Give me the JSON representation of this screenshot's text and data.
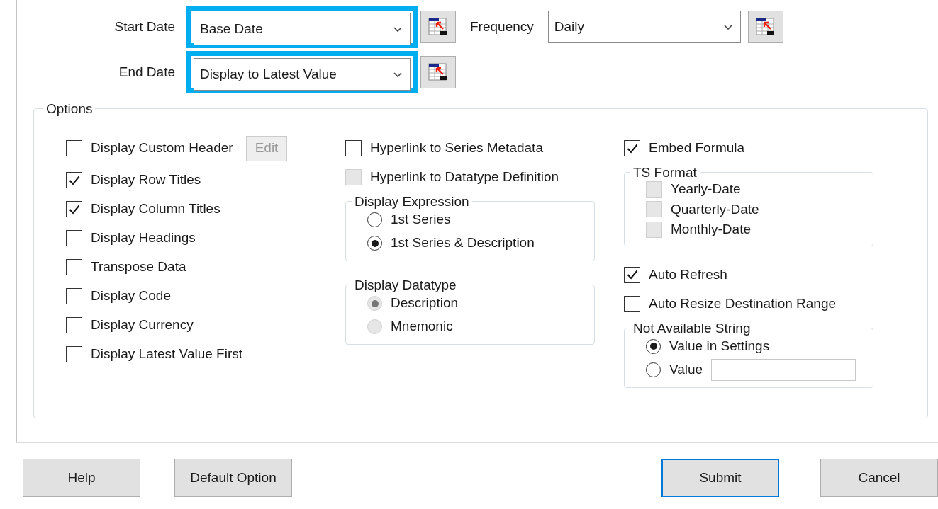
{
  "date_fields": [
    {
      "label": "Start Date",
      "value": "Base Date",
      "highlighted": true
    },
    {
      "label": "End Date",
      "value": "Display to Latest Value",
      "highlighted": true
    }
  ],
  "frequency": {
    "label": "Frequency",
    "value": "Daily"
  },
  "options": {
    "title": "Options",
    "columns": [
      [
        {
          "kind": "checkbox",
          "label": "Display Custom Header",
          "checked": false,
          "disabled": false,
          "button": {
            "label": "Edit",
            "disabled": true
          }
        },
        {
          "kind": "checkbox",
          "label": "Display Row Titles",
          "checked": true,
          "disabled": false
        },
        {
          "kind": "checkbox",
          "label": "Display Column Titles",
          "checked": true,
          "disabled": false
        },
        {
          "kind": "checkbox",
          "label": "Display Headings",
          "checked": false,
          "disabled": false
        },
        {
          "kind": "checkbox",
          "label": "Transpose Data",
          "checked": false,
          "disabled": false
        },
        {
          "kind": "checkbox",
          "label": "Display Code",
          "checked": false,
          "disabled": false
        },
        {
          "kind": "checkbox",
          "label": "Display Currency",
          "checked": false,
          "disabled": false
        },
        {
          "kind": "checkbox",
          "label": "Display Latest Value First",
          "checked": false,
          "disabled": false
        }
      ],
      [
        {
          "kind": "checkbox",
          "label": "Hyperlink to Series Metadata",
          "checked": false,
          "disabled": false
        },
        {
          "kind": "checkbox",
          "label": "Hyperlink to Datatype Definition",
          "checked": false,
          "disabled": true
        },
        {
          "kind": "radio_group",
          "title": "Display Expression",
          "options": [
            {
              "kind": "radio",
              "label": "1st Series",
              "selected": false,
              "disabled": false
            },
            {
              "kind": "radio",
              "label": "1st Series & Description",
              "selected": true,
              "disabled": false
            }
          ]
        },
        {
          "kind": "radio_group",
          "title": "Display Datatype",
          "options": [
            {
              "kind": "radio",
              "label": "Description",
              "selected": true,
              "disabled": true
            },
            {
              "kind": "radio",
              "label": "Mnemonic",
              "selected": false,
              "disabled": true
            }
          ]
        }
      ],
      [
        {
          "kind": "checkbox",
          "label": "Embed Formula",
          "checked": true,
          "disabled": false
        },
        {
          "kind": "checkbox_group",
          "title": "TS Format",
          "items": [
            {
              "label": "Yearly-Date",
              "checked": false,
              "disabled": true
            },
            {
              "label": "Quarterly-Date",
              "checked": false,
              "disabled": true
            },
            {
              "label": "Monthly-Date",
              "checked": false,
              "disabled": true
            }
          ]
        },
        {
          "kind": "checkbox",
          "label": "Auto Refresh",
          "checked": true,
          "disabled": false
        },
        {
          "kind": "checkbox",
          "label": "Auto Resize Destination Range",
          "checked": false,
          "disabled": false
        },
        {
          "kind": "radio_group",
          "title": "Not Available String",
          "options": [
            {
              "kind": "radio",
              "label": "Value in Settings",
              "selected": true,
              "disabled": false
            },
            {
              "kind": "radio_input",
              "label": "Value",
              "selected": false,
              "disabled": false
            }
          ]
        }
      ]
    ]
  },
  "button_bar": {
    "left": [
      {
        "label": "Help",
        "default": false
      },
      {
        "label": "Default Option",
        "default": false
      }
    ],
    "right": [
      {
        "label": "Submit",
        "default": true
      },
      {
        "label": "Cancel",
        "default": false
      }
    ]
  }
}
